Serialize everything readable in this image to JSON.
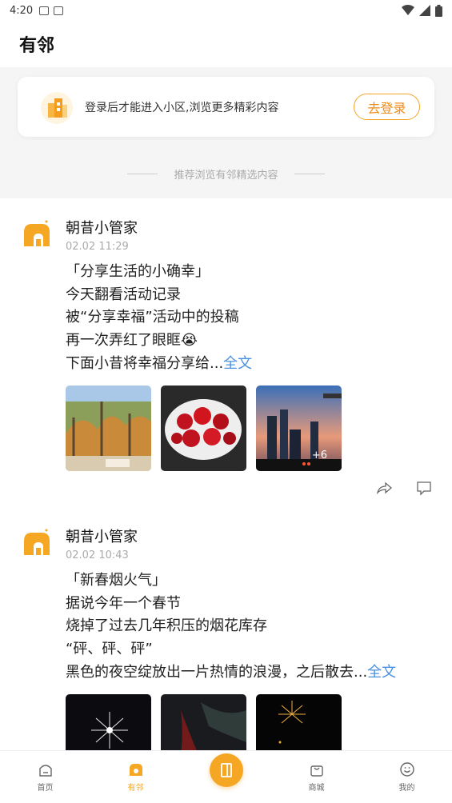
{
  "status_bar": {
    "time": "4:20"
  },
  "header": {
    "title": "有邻"
  },
  "login_banner": {
    "message": "登录后才能进入小区,浏览更多精彩内容",
    "button_label": "去登录"
  },
  "recommend_divider": "推荐浏览有邻精选内容",
  "posts": [
    {
      "author": "朝昔小管家",
      "time": "02.02 11:29",
      "lines": [
        "「分享生活的小确幸」",
        "今天翻看活动记录",
        "被“分享幸福”活动中的投稿",
        "再一次弄红了眼眶😭",
        "下面小昔将幸福分享给..."
      ],
      "more_label": "全文",
      "extra_images": "+6"
    },
    {
      "author": "朝昔小管家",
      "time": "02.02 10:43",
      "lines": [
        "「新春烟火气」",
        "据说今年一个春节",
        "烧掉了过去几年积压的烟花库存",
        "“砰、砰、砰”",
        "黑色的夜空绽放出一片热情的浪漫，之后散去..."
      ],
      "more_label": "全文"
    }
  ],
  "bottom_nav": {
    "items": [
      {
        "label": "首页"
      },
      {
        "label": "有邻"
      },
      {
        "label": "商城"
      },
      {
        "label": "我的"
      }
    ]
  },
  "colors": {
    "accent": "#f5a623",
    "link": "#4a90e2"
  }
}
